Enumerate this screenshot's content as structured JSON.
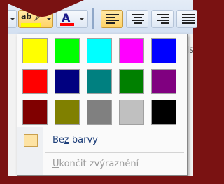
{
  "ribbon": {
    "highlight_button": {
      "icon": "text-highlight-icon",
      "label": "ab",
      "color": "#ffff00"
    },
    "font_color_button": {
      "icon": "font-color-icon",
      "label": "A",
      "color": "#ff0000"
    },
    "align_buttons": [
      "align-left-icon",
      "align-center-icon",
      "align-right-icon",
      "align-justify-icon"
    ],
    "active_align": "align-left-icon",
    "partial_text": "ds"
  },
  "highlight_menu": {
    "colors": [
      [
        "#ffff00",
        "#00ff00",
        "#00ffff",
        "#ff00ff",
        "#0000ff"
      ],
      [
        "#ff0000",
        "#000080",
        "#008080",
        "#008000",
        "#800080"
      ],
      [
        "#800000",
        "#808000",
        "#808080",
        "#c0c0c0",
        "#000000"
      ]
    ],
    "no_color": {
      "pre": "Be",
      "accel": "z",
      "post": " barvy"
    },
    "stop_highlighting": {
      "accel": "U",
      "post": "končit zvýraznění"
    }
  }
}
